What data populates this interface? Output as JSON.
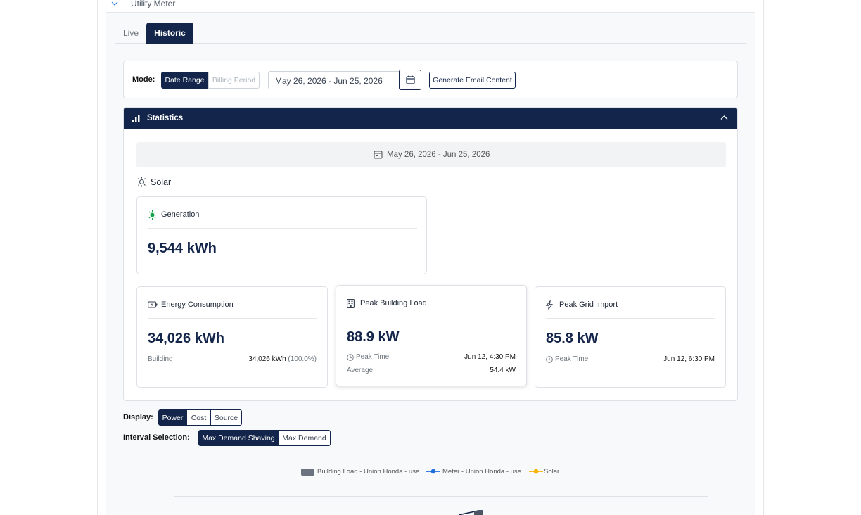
{
  "accordion": {
    "title": "Utility Meter"
  },
  "tabs": [
    {
      "label": "Live"
    },
    {
      "label": "Historic"
    }
  ],
  "mode": {
    "label": "Mode:",
    "options": [
      "Date Range",
      "Billing Period"
    ],
    "selected": "Date Range",
    "date_value": "May 26, 2026 - Jun 25, 2026",
    "generate_label": "Generate Email Content"
  },
  "statistics": {
    "title": "Statistics",
    "range": "May 26, 2026 - Jun 25, 2026",
    "solar_heading": "Solar",
    "generation": {
      "title": "Generation",
      "value": "9,544 kWh"
    },
    "energy": {
      "title": "Energy Consumption",
      "value": "34,026 kWh",
      "row_label": "Building",
      "row_value": "34,026 kWh",
      "row_pct": "(100.0%)"
    },
    "peak_building": {
      "title": "Peak Building Load",
      "value": "88.9 kW",
      "peak_time_label": "Peak Time",
      "peak_time_value": "Jun 12, 4:30 PM",
      "average_label": "Average",
      "average_value": "54.4 kW"
    },
    "peak_grid": {
      "title": "Peak Grid Import",
      "value": "85.8 kW",
      "peak_time_label": "Peak Time",
      "peak_time_value": "Jun 12, 6:30 PM"
    }
  },
  "display": {
    "label": "Display:",
    "options": [
      "Power",
      "Cost",
      "Source"
    ],
    "selected": "Power"
  },
  "interval": {
    "label": "Interval Selection:",
    "options": [
      "Max Demand Shaving",
      "Max Demand"
    ],
    "selected": "Max Demand Shaving"
  },
  "legend": [
    {
      "label": "Building Load - Union Honda - use",
      "color": "#6b7280",
      "icon": "bar-swatch"
    },
    {
      "label": "Meter - Union Honda - use",
      "color": "#1d6fe0",
      "icon": "line-dot"
    },
    {
      "label": "Solar",
      "color": "#f5b301",
      "icon": "line-dot"
    }
  ],
  "colors": {
    "primary": "#13254a",
    "sun_green": "#16a34a"
  }
}
